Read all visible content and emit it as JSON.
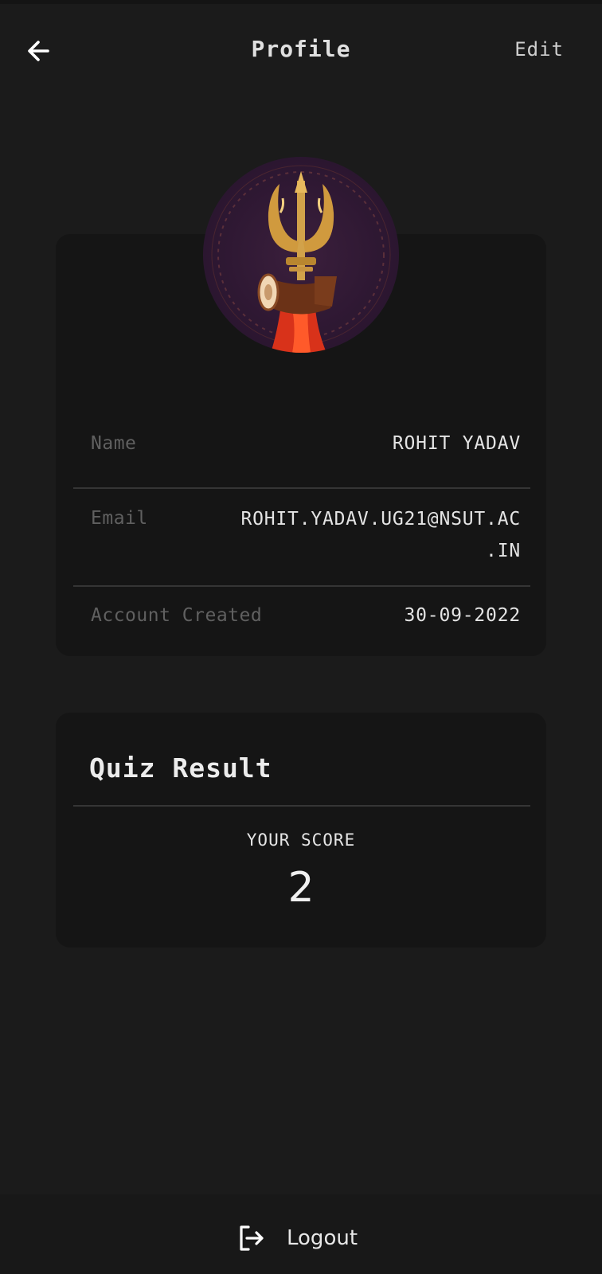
{
  "header": {
    "title": "Profile",
    "edit_label": "Edit",
    "back_icon": "arrow-left-icon"
  },
  "profile": {
    "avatar_icon": "trishul-damru-logo",
    "fields": [
      {
        "label": "Name",
        "value": "ROHIT YADAV"
      },
      {
        "label": "Email",
        "value_line1": "ROHIT.YADAV.UG21@NSUT.AC",
        "value_line2": ".IN"
      },
      {
        "label": "Account Created",
        "value": "30-09-2022"
      }
    ]
  },
  "quiz": {
    "title": "Quiz Result",
    "score_label": "YOUR SCORE",
    "score_value": "2"
  },
  "footer": {
    "logout_label": "Logout",
    "logout_icon": "logout-icon"
  },
  "colors": {
    "background": "#1b1b1b",
    "card": "#151515",
    "divider": "#353535",
    "label": "#606060",
    "text": "#e4e4e4"
  }
}
